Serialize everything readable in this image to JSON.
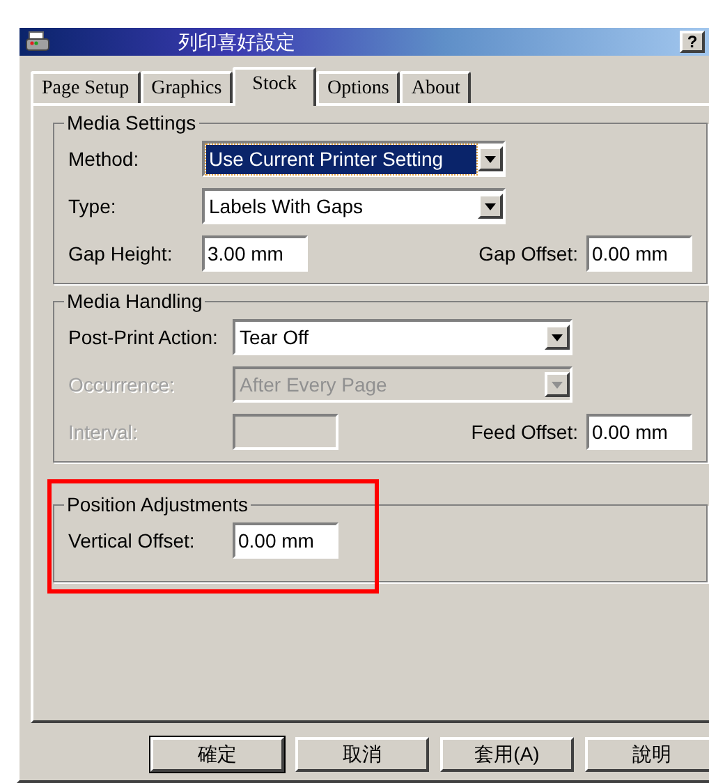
{
  "window": {
    "title": "列印喜好設定",
    "help_button": "?"
  },
  "tabs": [
    {
      "label": "Page Setup",
      "selected": false
    },
    {
      "label": "Graphics",
      "selected": false
    },
    {
      "label": "Stock",
      "selected": true
    },
    {
      "label": "Options",
      "selected": false
    },
    {
      "label": "About",
      "selected": false
    }
  ],
  "groups": [
    {
      "title": "Media Settings",
      "highlighted": false,
      "rows": [
        {
          "kind": "dropdown",
          "label": "Method:",
          "value": "Use Current Printer Setting",
          "focused": true,
          "disabled": false
        },
        {
          "kind": "dropdown",
          "label": "Type:",
          "value": "Labels With Gaps",
          "focused": false,
          "disabled": false
        },
        {
          "kind": "pair",
          "label": "Gap Height:",
          "value": "3.00 mm",
          "label2": "Gap Offset:",
          "value2": "0.00 mm",
          "disabled": false
        }
      ]
    },
    {
      "title": "Media Handling",
      "highlighted": false,
      "rows": [
        {
          "kind": "dropdown",
          "label": "Post-Print Action:",
          "value": "Tear Off",
          "focused": false,
          "disabled": false
        },
        {
          "kind": "dropdown",
          "label": "Occurrence:",
          "value": "After Every Page",
          "focused": false,
          "disabled": true
        },
        {
          "kind": "pair",
          "label": "Interval:",
          "value": "",
          "label2": "Feed Offset:",
          "value2": "0.00 mm",
          "disabled": true
        }
      ]
    },
    {
      "title": "Position Adjustments",
      "highlighted": true,
      "rows": [
        {
          "kind": "single",
          "label": "Vertical Offset:",
          "value": "0.00 mm",
          "disabled": false
        }
      ]
    }
  ],
  "buttons": [
    {
      "label": "確定",
      "default": true
    },
    {
      "label": "取消",
      "default": false
    },
    {
      "label": "套用(A)",
      "default": false
    },
    {
      "label": "說明",
      "default": false
    }
  ]
}
